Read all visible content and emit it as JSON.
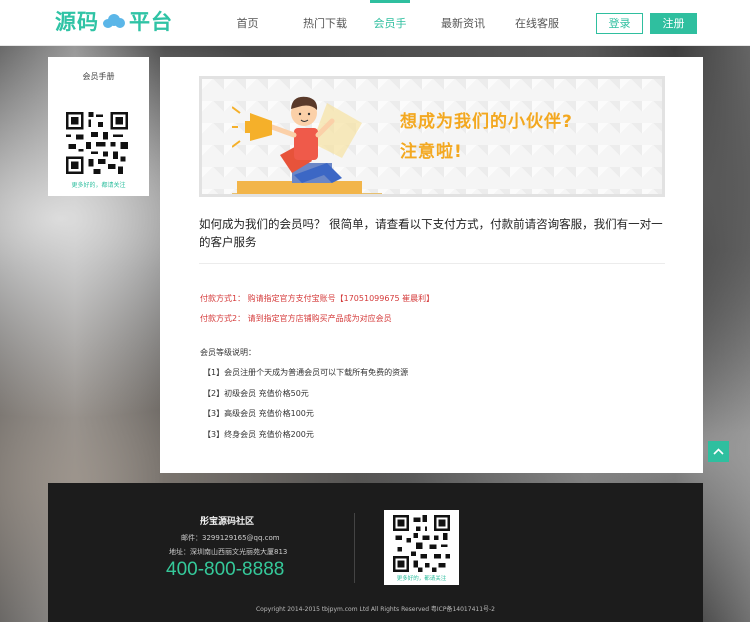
{
  "header": {
    "logo_text_left": "源码",
    "logo_text_right": "平台",
    "nav": [
      {
        "label": "首页",
        "active": false
      },
      {
        "label": "热门下载",
        "active": false
      },
      {
        "label": "会员手册",
        "active": true
      },
      {
        "label": "最新资讯",
        "active": false
      },
      {
        "label": "在线客服",
        "active": false
      }
    ],
    "login_label": "登录",
    "register_label": "注册"
  },
  "sidebar": {
    "title": "会员手册",
    "qr_caption": "更多好的，都请关注",
    "qr_icon": "qr-code-icon"
  },
  "main": {
    "banner": {
      "line1": "想成为我们的小伙伴?",
      "line2": "注意啦!"
    },
    "intro": "如何成为我们的会员吗？ 很简单，请查看以下支付方式，付款前请咨询客服，我们有一对一的客户服务",
    "payment_methods": [
      "付款方式1：  购请指定官方支付宝账号【17051099675 崔晨利】",
      "付款方式2：  请到指定官方店铺购买产品成为对应会员"
    ],
    "levels_title": "会员等级说明：",
    "levels": [
      "【1】会员注册个天成为普通会员可以下载所有免费的资源",
      "【2】初级会员 充值价格50元",
      "【3】高级会员 充值价格100元",
      "【3】终身会员 充值价格200元"
    ]
  },
  "back_to_top_icon": "chevron-up-icon",
  "footer": {
    "title": "彤宝源码社区",
    "email": "邮件：3299129165@qq.com",
    "address": "地址：深圳南山西丽文光丽苑大厦813",
    "phone": "400-800-8888",
    "qr_caption": "更多好的，都请关注",
    "copyright": "Copyright 2014-2015 tbjpym.com Ltd All Rights Reserved 粤ICP备14017411号-2"
  },
  "colors": {
    "accent": "#2fbf9f",
    "banner_text": "#f3a820",
    "payment_text": "#d53b3b",
    "footer_bg": "#1c1c1c"
  }
}
